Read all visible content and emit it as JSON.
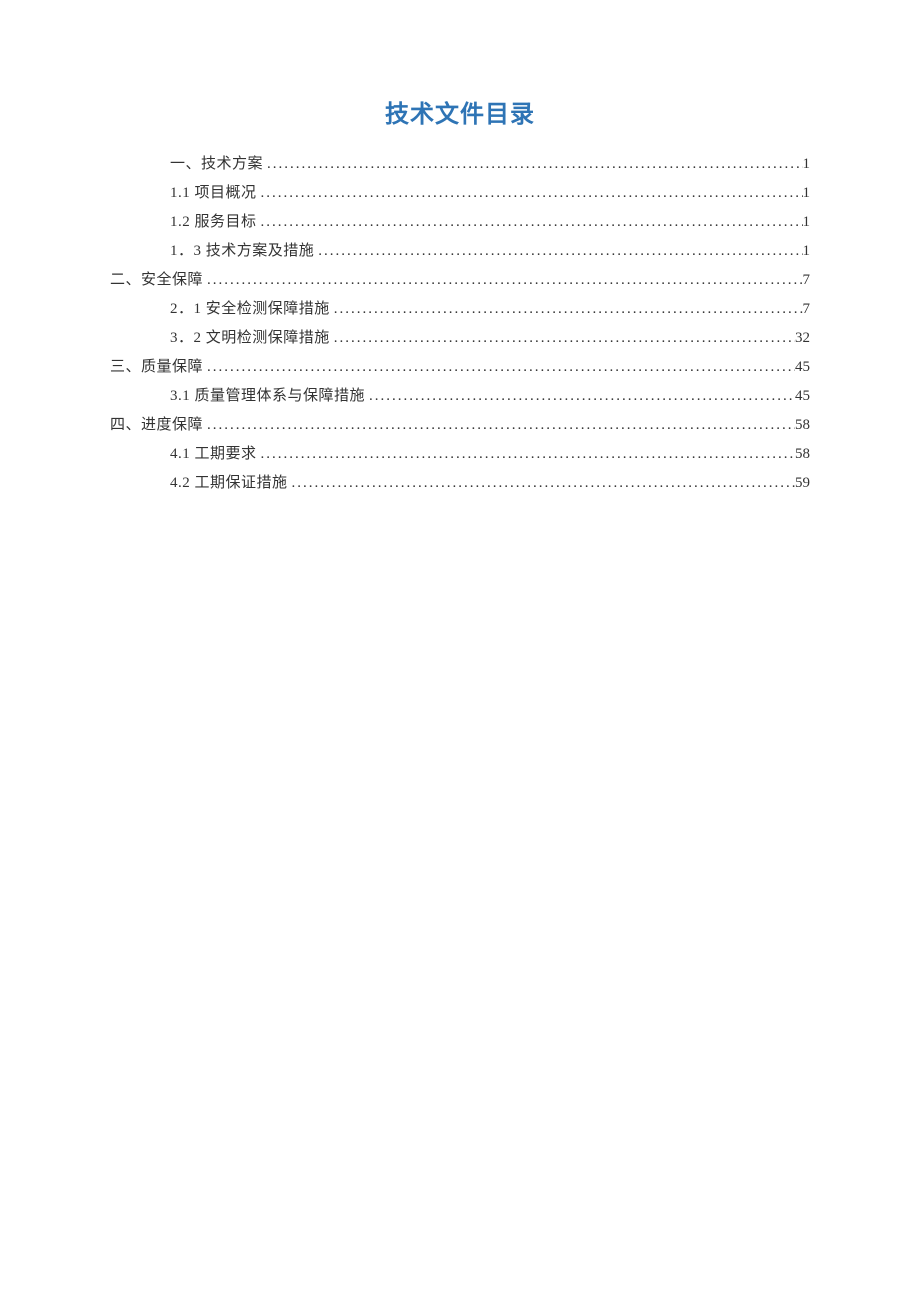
{
  "title": "技术文件目录",
  "toc": [
    {
      "level": 1,
      "label": "一、技术方案",
      "page": "1"
    },
    {
      "level": 2,
      "label": "1.1 项目概况",
      "page": "1"
    },
    {
      "level": 2,
      "label": "1.2 服务目标",
      "page": "1"
    },
    {
      "level": 2,
      "label": "1．3 技术方案及措施",
      "page": "1"
    },
    {
      "level": 0,
      "label": "二、安全保障",
      "page": "7"
    },
    {
      "level": 2,
      "label": "2．1 安全检测保障措施",
      "page": "7"
    },
    {
      "level": 2,
      "label": "3．2 文明检测保障措施",
      "page": "32"
    },
    {
      "level": 0,
      "label": "三、质量保障",
      "page": "45"
    },
    {
      "level": 2,
      "label": "3.1 质量管理体系与保障措施",
      "page": "45"
    },
    {
      "level": 0,
      "label": "四、进度保障",
      "page": "58"
    },
    {
      "level": 2,
      "label": "4.1 工期要求",
      "page": "58"
    },
    {
      "level": 2,
      "label": "4.2 工期保证措施",
      "page": "59"
    }
  ]
}
